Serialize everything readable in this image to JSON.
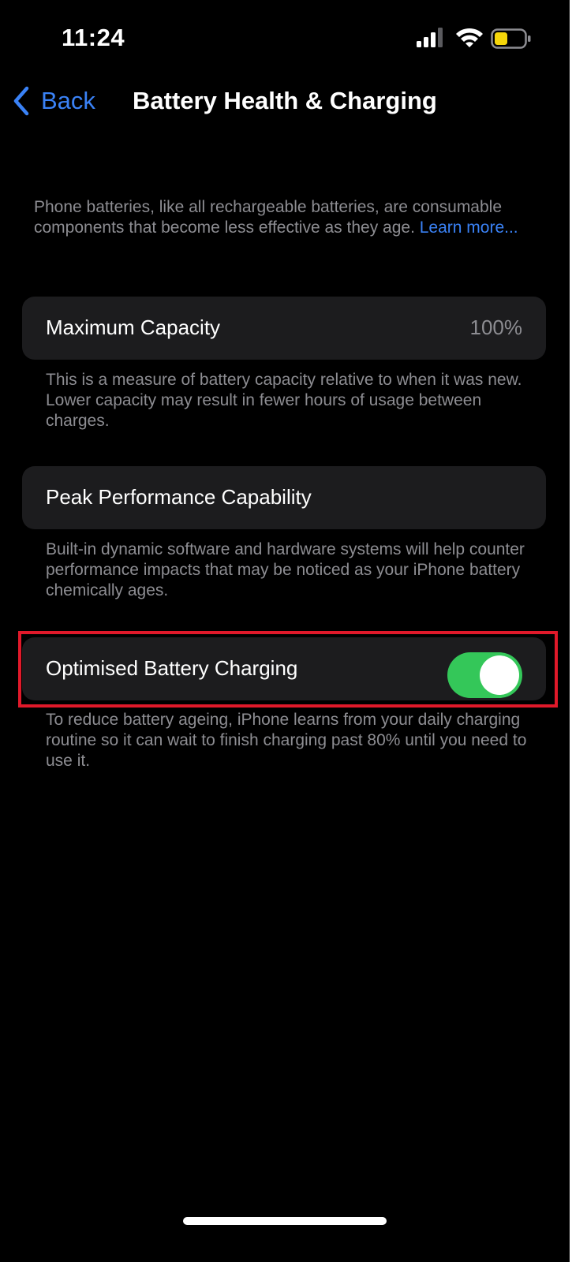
{
  "status_bar": {
    "time": "11:24",
    "icons": [
      "signal-icon",
      "wifi-icon",
      "battery-icon"
    ],
    "battery_color": "#f5d60a"
  },
  "nav": {
    "back_label": "Back",
    "title": "Battery Health & Charging"
  },
  "intro": {
    "text": "Phone batteries, like all rechargeable batteries, are consumable components that become less effective as they age.",
    "link": "Learn more..."
  },
  "sections": {
    "max_capacity": {
      "label": "Maximum Capacity",
      "value": "100%",
      "footnote": "This is a measure of battery capacity relative to when it was new. Lower capacity may result in fewer hours of usage between charges."
    },
    "peak_performance": {
      "label": "Peak Performance Capability",
      "footnote": "Built-in dynamic software and hardware systems will help counter performance impacts that may be noticed as your iPhone battery chemically ages."
    },
    "optimised_charging": {
      "label": "Optimised Battery Charging",
      "enabled": true,
      "footnote": "To reduce battery ageing, iPhone learns from your daily charging routine so it can wait to finish charging past 80% until you need to use it."
    }
  },
  "colors": {
    "accent": "#3a82f6",
    "toggle_on": "#34c759",
    "highlight": "#e0192a"
  }
}
